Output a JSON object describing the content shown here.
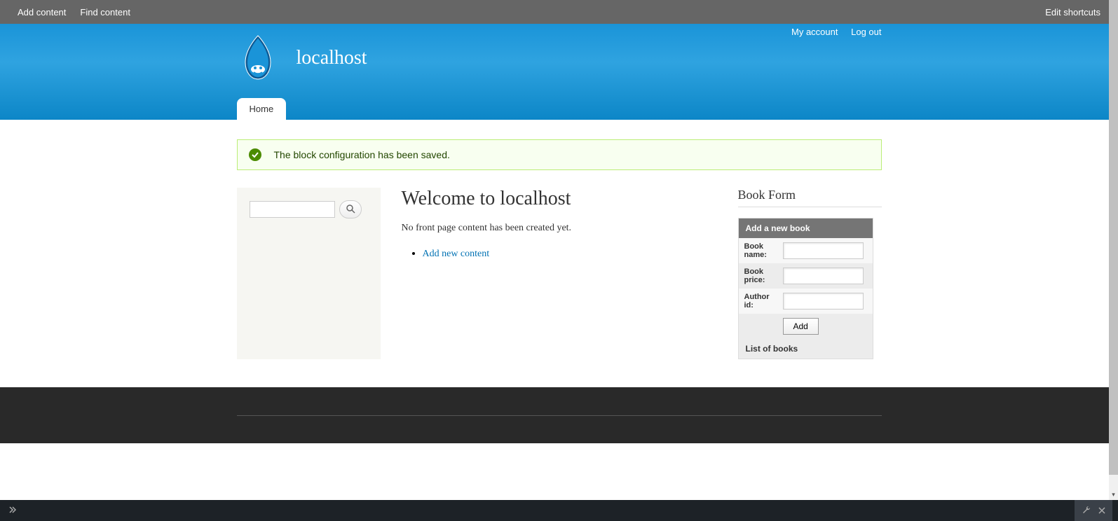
{
  "toolbar": {
    "add_content": "Add content",
    "find_content": "Find content",
    "edit_shortcuts": "Edit shortcuts"
  },
  "header": {
    "site_name": "localhost",
    "user_links": {
      "my_account": "My account",
      "log_out": "Log out"
    },
    "tabs": {
      "home": "Home"
    }
  },
  "status": {
    "message": "The block configuration has been saved."
  },
  "main": {
    "title": "Welcome to localhost",
    "lead": "No front page content has been created yet.",
    "add_link": "Add new content"
  },
  "book_form": {
    "block_title": "Book Form",
    "header": "Add a new book",
    "fields": {
      "name_label": "Book name:",
      "price_label": "Book price:",
      "author_label": "Author id:"
    },
    "add_button": "Add",
    "footer": "List of books"
  }
}
